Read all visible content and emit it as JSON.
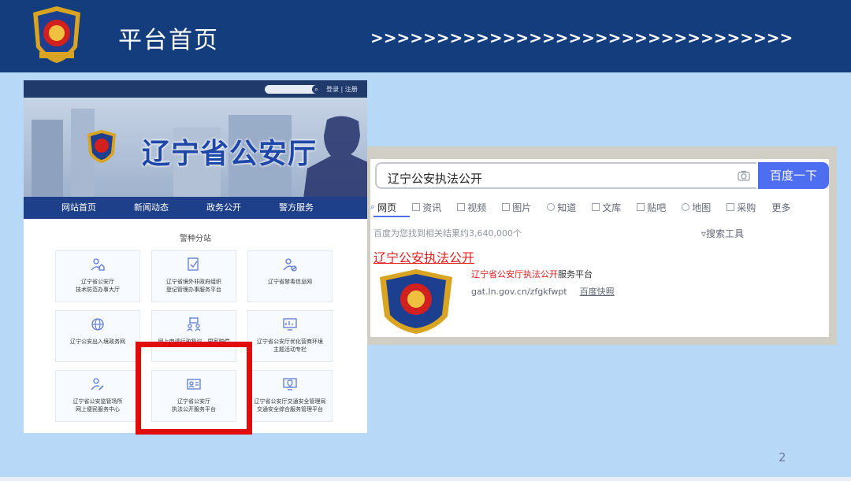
{
  "slide": {
    "title": "平台首页",
    "arrows": ">>>>>>>>>>>>>>>>>>>>>>>>>>>>>>>>",
    "page_number": "2"
  },
  "site": {
    "login": "登录 | 注册",
    "title": "辽宁省公安厅",
    "nav": [
      "网站首页",
      "新闻动态",
      "政务公开",
      "警方服务"
    ],
    "section_title": "警种分站",
    "tiles": [
      {
        "label": "辽宁省公安厅\n技术防范办事大厅",
        "icon": "user-house-icon"
      },
      {
        "label": "辽宁省境外非政府组织\n登记管理办事服务平台",
        "icon": "document-check-icon"
      },
      {
        "label": "辽宁省禁毒信息网",
        "icon": "user-ban-icon"
      },
      {
        "label": "辽宁公安出入境政务网",
        "icon": "globe-icon"
      },
      {
        "label": "网上申请行政复议、国家赔偿",
        "icon": "people-board-icon"
      },
      {
        "label": "辽宁省公安厅优化营商环境\n主题活动专栏",
        "icon": "chart-board-icon"
      },
      {
        "label": "辽宁省公安监管场所\n网上便民服务中心",
        "icon": "user-edit-icon"
      },
      {
        "label": "辽宁省公安厅\n执法公开服务平台",
        "icon": "id-card-icon"
      },
      {
        "label": "辽宁省公安厅交通安全管理局\n交通安全综合服务管理平台",
        "icon": "map-screen-icon"
      }
    ]
  },
  "search": {
    "query": "辽宁公安执法公开",
    "button": "百度一下",
    "tabs": [
      "网页",
      "资讯",
      "视频",
      "图片",
      "知道",
      "文库",
      "贴吧",
      "地图",
      "采购",
      "更多"
    ],
    "result_count": "百度为您找到相关结果约3,640,000个",
    "tools": "搜索工具",
    "result_title": "辽宁公安执法公开",
    "result_desc_hl": "辽宁省公安厅执法公开",
    "result_desc_rest": "服务平台",
    "result_url": "gat.ln.gov.cn/zfgkfwpt",
    "result_snapshot": "百度快照"
  }
}
